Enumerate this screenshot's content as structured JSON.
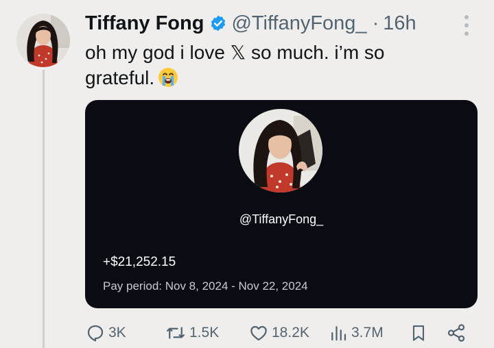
{
  "tweet": {
    "author_name": "Tiffany Fong",
    "handle": "@TiffanyFong_",
    "separator": "·",
    "time": "16h",
    "text": "oh my god i love 𝕏 so much. i’m so grateful."
  },
  "card": {
    "handle": "@TiffanyFong_",
    "amount": "+$21,252.15",
    "pay_period": "Pay period: Nov 8, 2024 - Nov 22, 2024"
  },
  "actions": {
    "replies": "3K",
    "reposts": "1.5K",
    "likes": "18.2K",
    "views": "3.7M"
  },
  "colors": {
    "background": "#efeeed",
    "card_background": "#0b0c13",
    "verified_badge": "#1d9bf0",
    "secondary_text": "#536471"
  },
  "icons": [
    "verified-badge-icon",
    "more-options-icon",
    "loudly-crying-face-emoji",
    "reply-icon",
    "repost-icon",
    "like-icon",
    "views-icon",
    "bookmark-icon",
    "share-icon"
  ]
}
